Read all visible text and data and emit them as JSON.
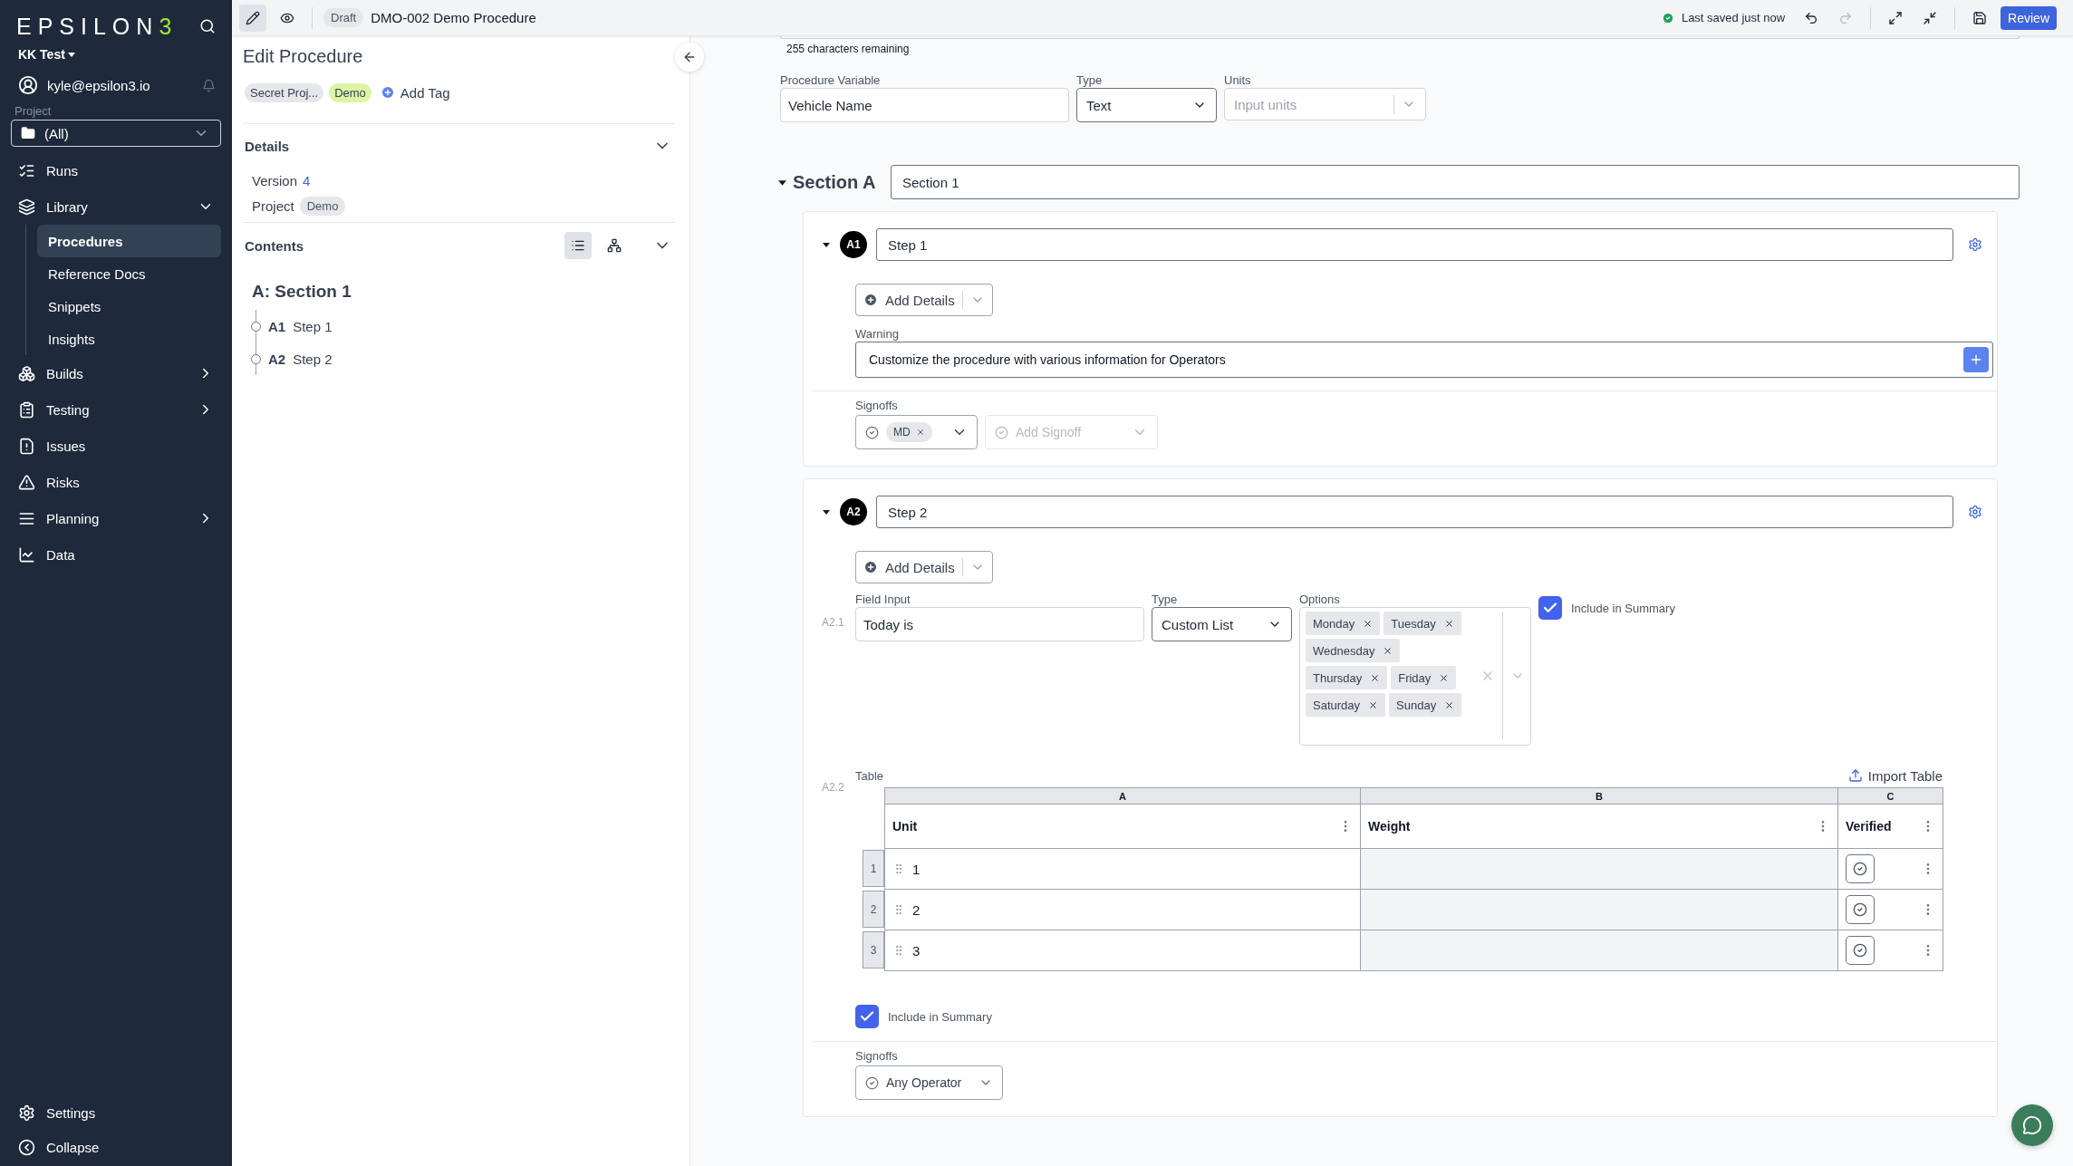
{
  "sidebar": {
    "logo": {
      "text": "EPSILON",
      "mark": "3"
    },
    "workspace": "KK Test",
    "user": "kyle@epsilon3.io",
    "project_label": "Project",
    "project": "(All)",
    "nav": [
      {
        "label": "Runs",
        "kind": "link"
      },
      {
        "label": "Library",
        "kind": "group",
        "expanded": true,
        "children": [
          {
            "label": "Procedures",
            "selected": true
          },
          {
            "label": "Reference Docs",
            "selected": false
          },
          {
            "label": "Snippets",
            "selected": false
          },
          {
            "label": "Insights",
            "selected": false
          }
        ]
      },
      {
        "label": "Builds",
        "kind": "group",
        "expanded": false
      },
      {
        "label": "Testing",
        "kind": "group",
        "expanded": false
      },
      {
        "label": "Issues",
        "kind": "link"
      },
      {
        "label": "Risks",
        "kind": "link"
      },
      {
        "label": "Planning",
        "kind": "group",
        "expanded": false
      },
      {
        "label": "Data",
        "kind": "link"
      }
    ],
    "footer": [
      {
        "label": "Settings",
        "kind": "settings"
      },
      {
        "label": "Collapse",
        "kind": "collapse"
      }
    ]
  },
  "topbar": {
    "modes": [
      {
        "kind": "edit",
        "selected": true
      },
      {
        "kind": "preview",
        "selected": false
      }
    ],
    "status": "Draft",
    "title": "DMO-002 Demo Procedure",
    "save_status": "Last saved just now",
    "actions": [
      {
        "kind": "undo",
        "disabled": false
      },
      {
        "kind": "redo",
        "disabled": true
      },
      {
        "kind": "expand",
        "disabled": false
      },
      {
        "kind": "shrink",
        "disabled": false
      },
      {
        "kind": "save",
        "disabled": false
      }
    ],
    "review": "Review"
  },
  "edit_panel": {
    "title": "Edit Procedure",
    "tags": [
      {
        "label": "Secret Proj...",
        "color": "#e5e7eb"
      },
      {
        "label": "Demo",
        "color": "#dcf5a4"
      }
    ],
    "add_tag": "Add Tag",
    "details": {
      "heading": "Details",
      "expanded": true,
      "version_label": "Version",
      "version": "4",
      "project_label": "Project",
      "project": "Demo"
    },
    "contents": {
      "heading": "Contents",
      "expanded": true,
      "views": [
        {
          "kind": "list",
          "selected": true
        },
        {
          "kind": "tree",
          "selected": false
        }
      ],
      "sections": [
        {
          "title": "A: Section 1",
          "steps": [
            {
              "key": "A1",
              "name": "Step 1"
            },
            {
              "key": "A2",
              "name": "Step 2"
            }
          ]
        }
      ]
    }
  },
  "editor": {
    "counter": "255 characters remaining",
    "variable": {
      "label": "Procedure Variable",
      "value": "Vehicle Name"
    },
    "variable_type": {
      "label": "Type",
      "value": "Text"
    },
    "units": {
      "label": "Units",
      "placeholder": "Input units"
    },
    "sections": [
      {
        "label": "Section A",
        "title": "Section 1",
        "expanded": true,
        "steps": [
          {
            "key": "A1",
            "title": "Step 1",
            "expanded": true,
            "add_details": "Add Details",
            "blocks": [
              {
                "kind": "warning",
                "label": "Warning",
                "text": "Customize the procedure with various information for Operators"
              }
            ],
            "signoffs": {
              "label": "Signoffs",
              "chips": [
                "MD"
              ],
              "add_placeholder": "Add Signoff"
            }
          },
          {
            "key": "A2",
            "title": "Step 2",
            "expanded": true,
            "add_details": "Add Details",
            "blocks": [
              {
                "kind": "field_input",
                "number": "A2.1",
                "label": "Field Input",
                "value": "Today is",
                "type_label": "Type",
                "type": "Custom List",
                "options_label": "Options",
                "options": [
                  "Monday",
                  "Tuesday",
                  "Wednesday",
                  "Thursday",
                  "Friday",
                  "Saturday",
                  "Sunday"
                ],
                "include_in_summary": true,
                "include_label": "Include in Summary"
              },
              {
                "kind": "table",
                "number": "A2.2",
                "label": "Table",
                "import": "Import Table",
                "letters": [
                  "A",
                  "B",
                  "C"
                ],
                "columns": [
                  {
                    "name": "Unit",
                    "kind": "text"
                  },
                  {
                    "name": "Weight",
                    "kind": "locked"
                  },
                  {
                    "name": "Verified",
                    "kind": "signoff"
                  }
                ],
                "rows": [
                  {
                    "number": "1",
                    "value": "1"
                  },
                  {
                    "number": "2",
                    "value": "2"
                  },
                  {
                    "number": "3",
                    "value": "3"
                  }
                ],
                "include_in_summary": true,
                "include_label": "Include in Summary"
              }
            ],
            "signoffs": {
              "label": "Signoffs",
              "value": "Any Operator"
            }
          }
        ]
      }
    ]
  }
}
